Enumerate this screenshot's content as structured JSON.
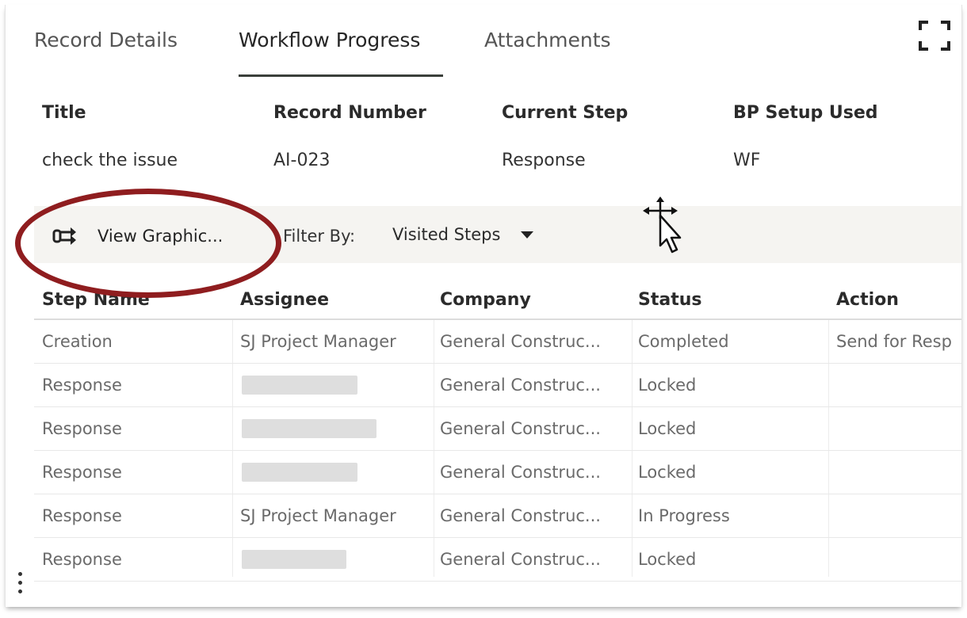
{
  "tabs": [
    {
      "label": "Record Details",
      "active": false
    },
    {
      "label": "Workflow Progress",
      "active": true
    },
    {
      "label": "Attachments",
      "active": false
    }
  ],
  "record": {
    "labels": {
      "title": "Title",
      "record_number": "Record Number",
      "current_step": "Current Step",
      "bp_setup": "BP Setup Used"
    },
    "values": {
      "title": "check the issue",
      "record_number": "AI-023",
      "current_step": "Response",
      "bp_setup": "WF"
    }
  },
  "toolbar": {
    "view_graphic_label": "View Graphic...",
    "view_graphic_icon": "workflow-icon",
    "filter_label": "Filter By:",
    "filter_value": "Visited Steps"
  },
  "table": {
    "headers": [
      "Step Name",
      "Assignee",
      "Company",
      "Status",
      "Action"
    ],
    "rows": [
      {
        "step": "Creation",
        "assignee": "SJ Project Manager",
        "assignee_redacted": false,
        "company": "General Construc...",
        "status": "Completed",
        "action": "Send for Resp"
      },
      {
        "step": "Response",
        "assignee": "",
        "assignee_redacted": true,
        "company": "General Construc...",
        "status": "Locked",
        "action": ""
      },
      {
        "step": "Response",
        "assignee": "",
        "assignee_redacted": true,
        "company": "General Construc...",
        "status": "Locked",
        "action": ""
      },
      {
        "step": "Response",
        "assignee": "",
        "assignee_redacted": true,
        "company": "General Construc...",
        "status": "Locked",
        "action": ""
      },
      {
        "step": "Response",
        "assignee": "SJ Project Manager",
        "assignee_redacted": false,
        "company": "General Construc...",
        "status": "In Progress",
        "action": ""
      },
      {
        "step": "Response",
        "assignee": "",
        "assignee_redacted": true,
        "company": "General Construc...",
        "status": "Locked",
        "action": ""
      }
    ]
  },
  "colors": {
    "highlight": "#8f1d1f",
    "tab_underline": "#3a3f3a",
    "toolbar_bg": "#f5f4f1"
  },
  "icons": {
    "expand": "expand-icon",
    "more": "kebab-menu-icon",
    "cursor": "move-cursor-icon"
  }
}
